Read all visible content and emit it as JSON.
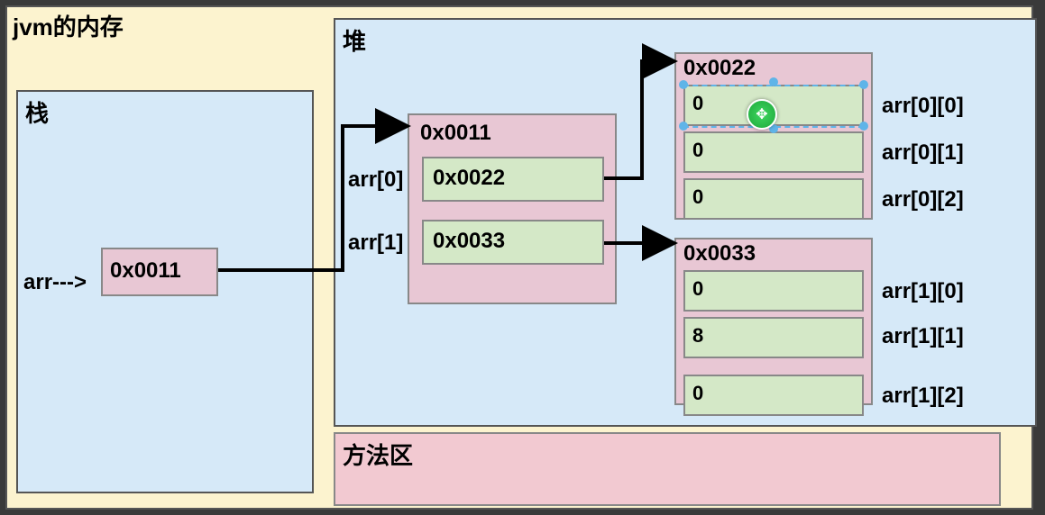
{
  "jvm_title": "jvm的内存",
  "stack": {
    "title": "栈",
    "arr_label": "arr--->",
    "value": "0x0011"
  },
  "heap": {
    "title": "堆",
    "arr_block": {
      "addr": "0x0011",
      "items": [
        "0x0022",
        "0x0033"
      ],
      "labels": [
        "arr[0]",
        "arr[1]"
      ]
    },
    "sub0": {
      "addr": "0x0022",
      "values": [
        "0",
        "0",
        "0"
      ],
      "labels": [
        "arr[0][0]",
        "arr[0][1]",
        "arr[0][2]"
      ]
    },
    "sub1": {
      "addr": "0x0033",
      "values": [
        "0",
        "8",
        "0"
      ],
      "labels": [
        "arr[1][0]",
        "arr[1][1]",
        "arr[1][2]"
      ]
    }
  },
  "method_area": {
    "title": "方法区"
  },
  "cursor_glyph": "✥"
}
